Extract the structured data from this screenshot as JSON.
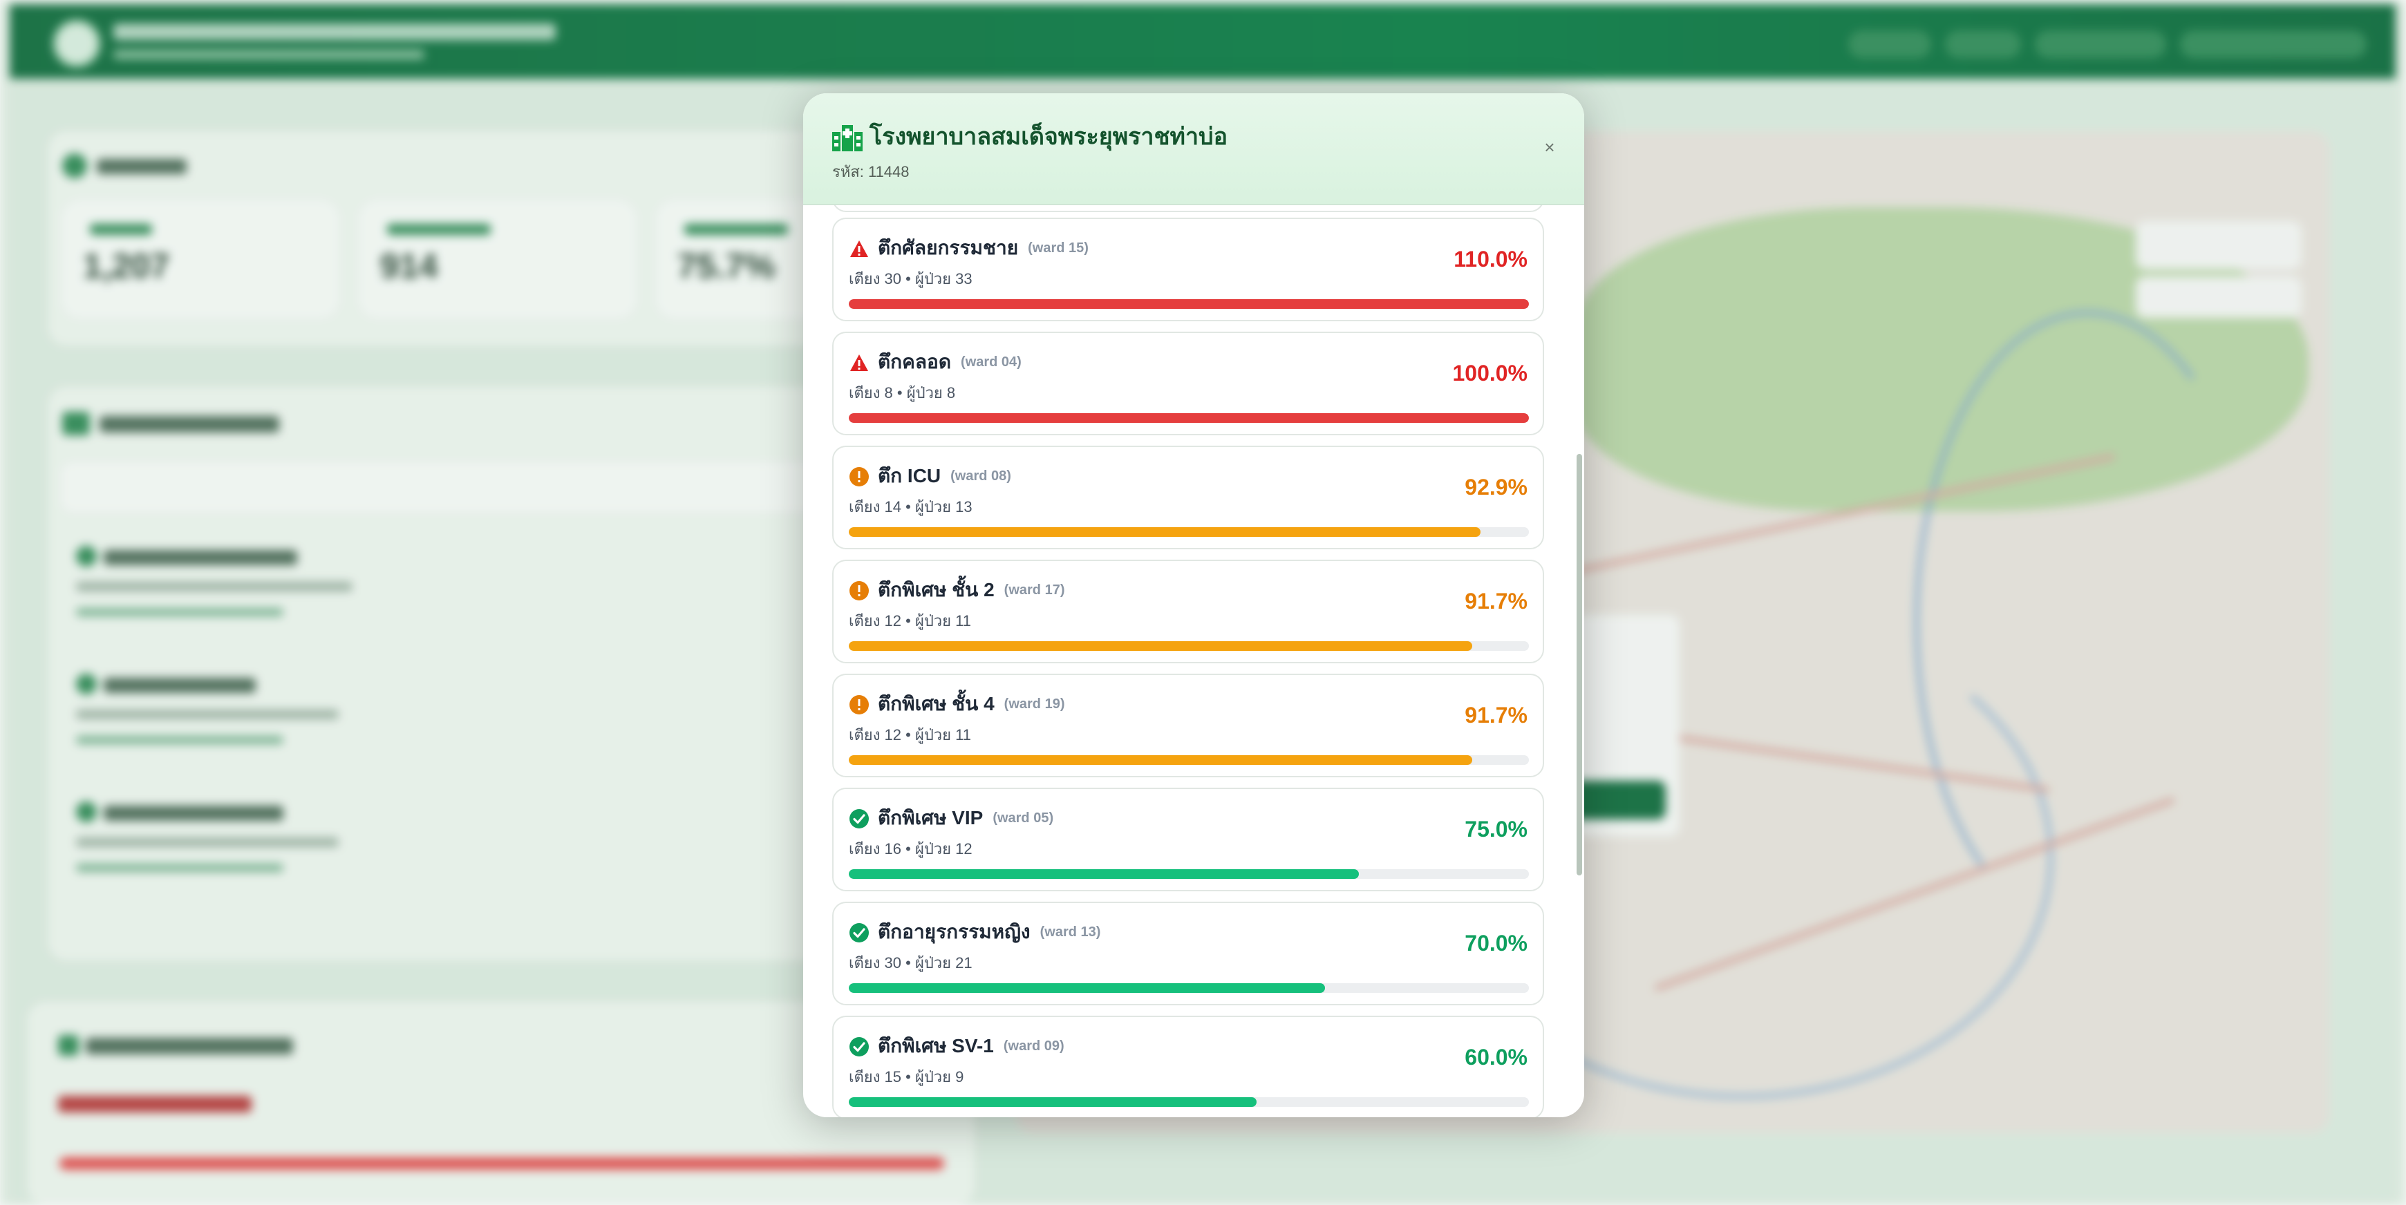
{
  "modal": {
    "title": "โรงพยาบาลสมเด็จพระยุพราชท่าบ่อ",
    "code": "รหัส: 11448",
    "close_label": "×"
  },
  "colors": {
    "critical": "#e02424",
    "warning": "#e67e06",
    "normal": "#0e9f5e",
    "bar_critical": "#e53e3e",
    "bar_warning": "#f5a30f",
    "bar_normal": "#16c07c",
    "header_bg": "#dff4e4",
    "title_text": "#14532d"
  },
  "wards": [
    {
      "name": "ตึกศัลยกรรมชาย",
      "code": "(ward 15)",
      "info": "เตียง 30 • ผู้ป่วย 33",
      "percent_label": "110.0%",
      "occupancy": 110.0,
      "status": "critical",
      "status_icon": "warning-triangle-icon"
    },
    {
      "name": "ตึกคลอด",
      "code": "(ward 04)",
      "info": "เตียง 8 • ผู้ป่วย 8",
      "percent_label": "100.0%",
      "occupancy": 100.0,
      "status": "critical",
      "status_icon": "warning-triangle-icon"
    },
    {
      "name": "ตึก ICU",
      "code": "(ward 08)",
      "info": "เตียง 14 • ผู้ป่วย 13",
      "percent_label": "92.9%",
      "occupancy": 92.9,
      "status": "warning",
      "status_icon": "exclamation-circle-icon"
    },
    {
      "name": "ตึกพิเศษ ชั้น 2",
      "code": "(ward 17)",
      "info": "เตียง 12 • ผู้ป่วย 11",
      "percent_label": "91.7%",
      "occupancy": 91.7,
      "status": "warning",
      "status_icon": "exclamation-circle-icon"
    },
    {
      "name": "ตึกพิเศษ ชั้น 4",
      "code": "(ward 19)",
      "info": "เตียง 12 • ผู้ป่วย 11",
      "percent_label": "91.7%",
      "occupancy": 91.7,
      "status": "warning",
      "status_icon": "exclamation-circle-icon"
    },
    {
      "name": "ตึกพิเศษ VIP",
      "code": "(ward 05)",
      "info": "เตียง 16 • ผู้ป่วย 12",
      "percent_label": "75.0%",
      "occupancy": 75.0,
      "status": "normal",
      "status_icon": "check-circle-icon"
    },
    {
      "name": "ตึกอายุรกรรมหญิง",
      "code": "(ward 13)",
      "info": "เตียง 30 • ผู้ป่วย 21",
      "percent_label": "70.0%",
      "occupancy": 70.0,
      "status": "normal",
      "status_icon": "check-circle-icon"
    },
    {
      "name": "ตึกพิเศษ SV-1",
      "code": "(ward 09)",
      "info": "เตียง 15 • ผู้ป่วย 9",
      "percent_label": "60.0%",
      "occupancy": 60.0,
      "status": "normal",
      "status_icon": "check-circle-icon"
    }
  ],
  "background": {
    "stats": [
      "1,207",
      "914",
      "75.7%"
    ]
  }
}
